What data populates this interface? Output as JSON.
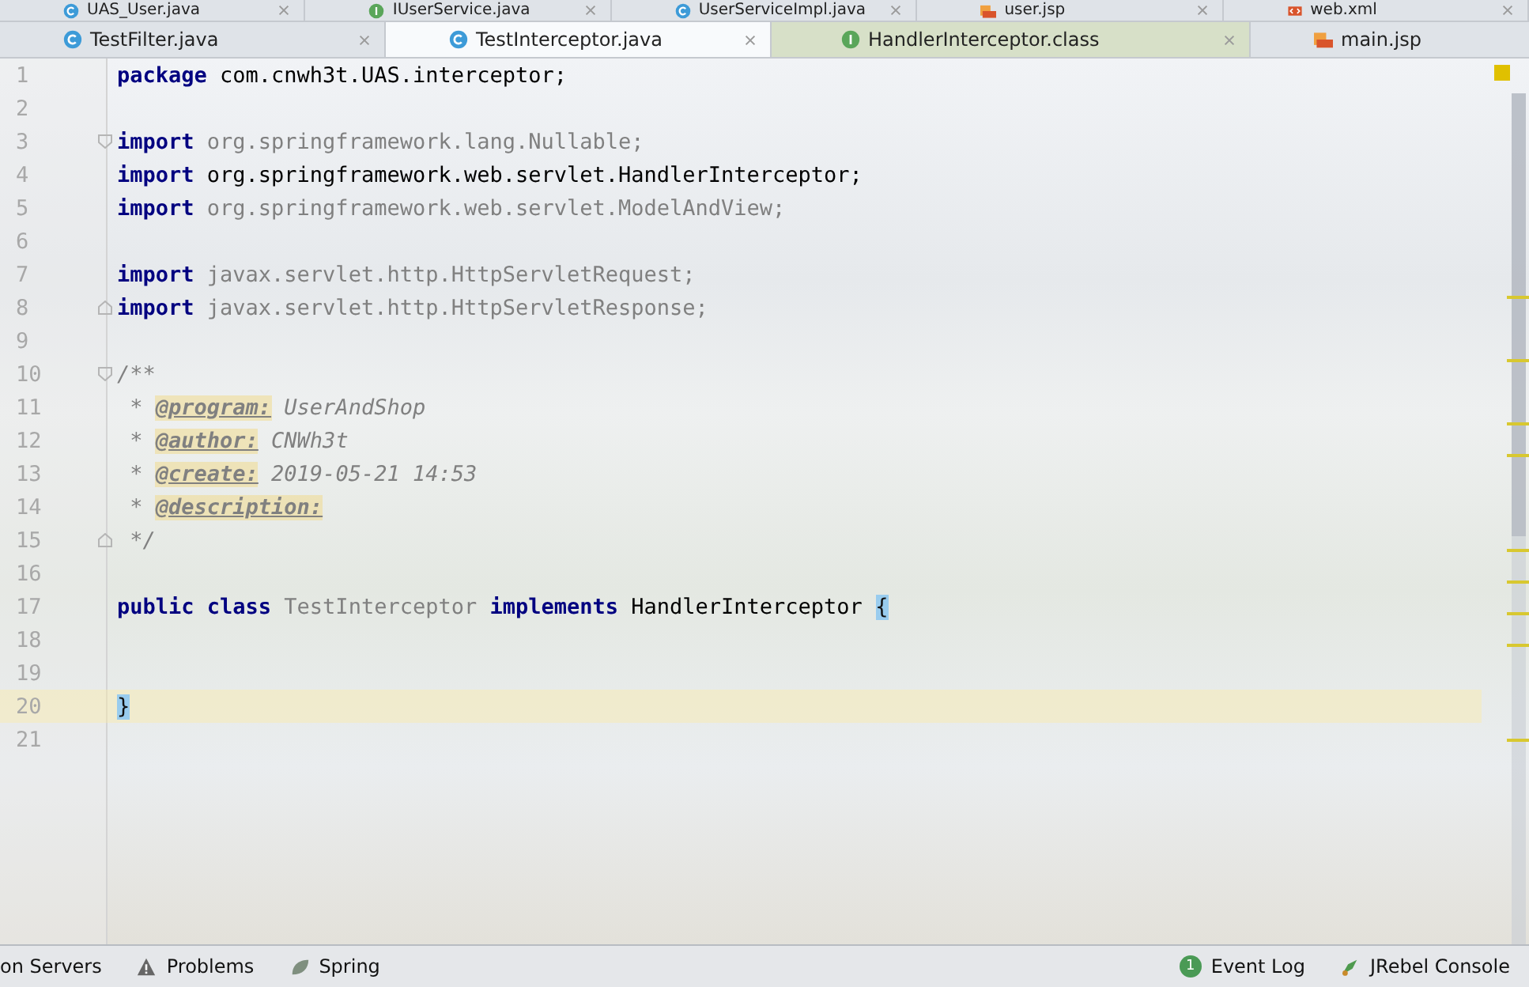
{
  "tab_rows": [
    {
      "tabs": [
        {
          "label": "UAS_User.java",
          "kind": "class",
          "selected": false,
          "library": false
        },
        {
          "label": "IUserService.java",
          "kind": "interface",
          "selected": false,
          "library": false
        },
        {
          "label": "UserServiceImpl.java",
          "kind": "class",
          "selected": false,
          "library": false
        },
        {
          "label": "user.jsp",
          "kind": "jsp",
          "selected": false,
          "library": false
        },
        {
          "label": "web.xml",
          "kind": "xml",
          "selected": false,
          "library": false
        }
      ]
    },
    {
      "tabs": [
        {
          "label": "TestFilter.java",
          "kind": "class",
          "selected": false,
          "library": false
        },
        {
          "label": "TestInterceptor.java",
          "kind": "class",
          "selected": true,
          "library": false
        },
        {
          "label": "HandlerInterceptor.class",
          "kind": "interface",
          "selected": false,
          "library": true
        },
        {
          "label": "main.jsp",
          "kind": "jsp",
          "selected": false,
          "library": false
        }
      ]
    }
  ],
  "editor": {
    "lines": [
      {
        "number": "1",
        "current": false,
        "kind": "code",
        "tokens": [
          {
            "text": "package",
            "kind": "keyword"
          },
          {
            "text": " com.cnwh3t.UAS.interceptor;",
            "kind": "plain"
          }
        ]
      },
      {
        "number": "2",
        "current": false,
        "kind": "code"
      },
      {
        "number": "3",
        "current": false,
        "kind": "fold-start",
        "tokens": [
          {
            "text": "import",
            "kind": "keyword"
          },
          {
            "text": " org.springframework.lang.Nullable;",
            "kind": "unused"
          }
        ]
      },
      {
        "number": "4",
        "current": false,
        "kind": "code",
        "tokens": [
          {
            "text": "import",
            "kind": "keyword"
          },
          {
            "text": " org.springframework.web.servlet.HandlerInterceptor;",
            "kind": "plain"
          }
        ]
      },
      {
        "number": "5",
        "current": false,
        "kind": "code",
        "tokens": [
          {
            "text": "import",
            "kind": "keyword"
          },
          {
            "text": " org.springframework.web.servlet.ModelAndView;",
            "kind": "unused"
          }
        ]
      },
      {
        "number": "6",
        "current": false,
        "kind": "code"
      },
      {
        "number": "7",
        "current": false,
        "kind": "code",
        "tokens": [
          {
            "text": "import",
            "kind": "keyword"
          },
          {
            "text": " javax.servlet.http.HttpServletRequest;",
            "kind": "unused"
          }
        ]
      },
      {
        "number": "8",
        "current": false,
        "kind": "fold-end",
        "tokens": [
          {
            "text": "import",
            "kind": "keyword"
          },
          {
            "text": " javax.servlet.http.HttpServletResponse;",
            "kind": "unused"
          }
        ]
      },
      {
        "number": "9",
        "current": false,
        "kind": "code"
      },
      {
        "number": "10",
        "current": false,
        "kind": "fold-start",
        "tokens": [
          {
            "text": "/**",
            "kind": "doc"
          }
        ]
      },
      {
        "number": "11",
        "current": false,
        "kind": "code",
        "tokens": [
          {
            "text": " * ",
            "kind": "doc"
          },
          {
            "text": "@program:",
            "kind": "doctag"
          },
          {
            "text": " UserAndShop",
            "kind": "doc"
          }
        ]
      },
      {
        "number": "12",
        "current": false,
        "kind": "code",
        "tokens": [
          {
            "text": " * ",
            "kind": "doc"
          },
          {
            "text": "@author:",
            "kind": "doctag"
          },
          {
            "text": " CNWh3t",
            "kind": "doc"
          }
        ]
      },
      {
        "number": "13",
        "current": false,
        "kind": "code",
        "tokens": [
          {
            "text": " * ",
            "kind": "doc"
          },
          {
            "text": "@create:",
            "kind": "doctag"
          },
          {
            "text": " 2019-05-21 14:53",
            "kind": "doc"
          }
        ]
      },
      {
        "number": "14",
        "current": false,
        "kind": "code",
        "tokens": [
          {
            "text": " * ",
            "kind": "doc"
          },
          {
            "text": "@description:",
            "kind": "doctag"
          }
        ]
      },
      {
        "number": "15",
        "current": false,
        "kind": "fold-end",
        "tokens": [
          {
            "text": " */",
            "kind": "doc"
          }
        ]
      },
      {
        "number": "16",
        "current": false,
        "kind": "code"
      },
      {
        "number": "17",
        "current": false,
        "kind": "code",
        "tokens": [
          {
            "text": "public class",
            "kind": "keyword"
          },
          {
            "text": " TestInterceptor ",
            "kind": "unused"
          },
          {
            "text": "implements",
            "kind": "keyword"
          },
          {
            "text": " HandlerInterceptor ",
            "kind": "plain"
          },
          {
            "text": "{",
            "kind": "brace"
          }
        ]
      },
      {
        "number": "18",
        "current": false,
        "kind": "code"
      },
      {
        "number": "19",
        "current": false,
        "kind": "code"
      },
      {
        "number": "20",
        "current": true,
        "kind": "code",
        "tokens": [
          {
            "text": "}",
            "kind": "brace"
          }
        ]
      },
      {
        "number": "21",
        "current": false,
        "kind": "code"
      }
    ]
  },
  "status_bar": {
    "left": [
      {
        "label": "on Servers",
        "kind": "text"
      },
      {
        "label": "Problems",
        "kind": "warning"
      },
      {
        "label": "Spring",
        "kind": "leaf"
      }
    ],
    "right": [
      {
        "label": "Event Log",
        "kind": "count",
        "count": "1"
      },
      {
        "label": "JRebel Console",
        "kind": "rebel"
      }
    ]
  }
}
